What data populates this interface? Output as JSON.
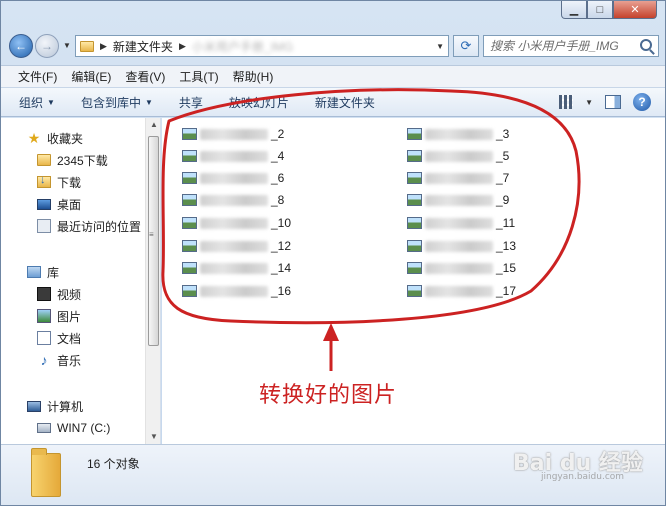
{
  "titlebar": {
    "minimize": "▁",
    "maximize": "□",
    "close": "✕"
  },
  "address": {
    "crumbs": [
      "新建文件夹",
      "小米用户手册_IMG"
    ],
    "search_placeholder": "搜索 小米用户手册_IMG"
  },
  "menubar": [
    "文件(F)",
    "编辑(E)",
    "查看(V)",
    "工具(T)",
    "帮助(H)"
  ],
  "commandbar": [
    {
      "label": "组织",
      "dropdown": true
    },
    {
      "label": "包含到库中",
      "dropdown": true
    },
    {
      "label": "共享",
      "dropdown": false
    },
    {
      "label": "放映幻灯片",
      "dropdown": false
    },
    {
      "label": "新建文件夹",
      "dropdown": false
    }
  ],
  "navpane": {
    "favorites": {
      "label": "收藏夹",
      "icon": "star-icon"
    },
    "favorite_items": [
      {
        "label": "2345下载",
        "icon": "folder-icon"
      },
      {
        "label": "下载",
        "icon": "downloads-icon"
      },
      {
        "label": "桌面",
        "icon": "desktop-icon"
      },
      {
        "label": "最近访问的位置",
        "icon": "recent-places-icon"
      }
    ],
    "libraries": {
      "label": "库",
      "icon": "library-icon"
    },
    "library_items": [
      {
        "label": "视频",
        "icon": "video-icon"
      },
      {
        "label": "图片",
        "icon": "pictures-icon"
      },
      {
        "label": "文档",
        "icon": "documents-icon"
      },
      {
        "label": "音乐",
        "icon": "music-icon"
      }
    ],
    "computer": {
      "label": "计算机",
      "icon": "computer-icon"
    },
    "computer_items": [
      {
        "label": "WIN7 (C:)",
        "icon": "drive-icon"
      }
    ]
  },
  "files": [
    {
      "suffix": "_2"
    },
    {
      "suffix": "_3"
    },
    {
      "suffix": "_4"
    },
    {
      "suffix": "_5"
    },
    {
      "suffix": "_6"
    },
    {
      "suffix": "_7"
    },
    {
      "suffix": "_8"
    },
    {
      "suffix": "_9"
    },
    {
      "suffix": "_10"
    },
    {
      "suffix": "_11"
    },
    {
      "suffix": "_12"
    },
    {
      "suffix": "_13"
    },
    {
      "suffix": "_14"
    },
    {
      "suffix": "_15"
    },
    {
      "suffix": "_16"
    },
    {
      "suffix": "_17"
    }
  ],
  "annotation": {
    "label": "转换好的图片",
    "color": "#cc2222"
  },
  "status": {
    "count": "16 个对象"
  },
  "watermark": {
    "brand": "Bai du 经验",
    "url": "jingyan.baidu.com"
  }
}
